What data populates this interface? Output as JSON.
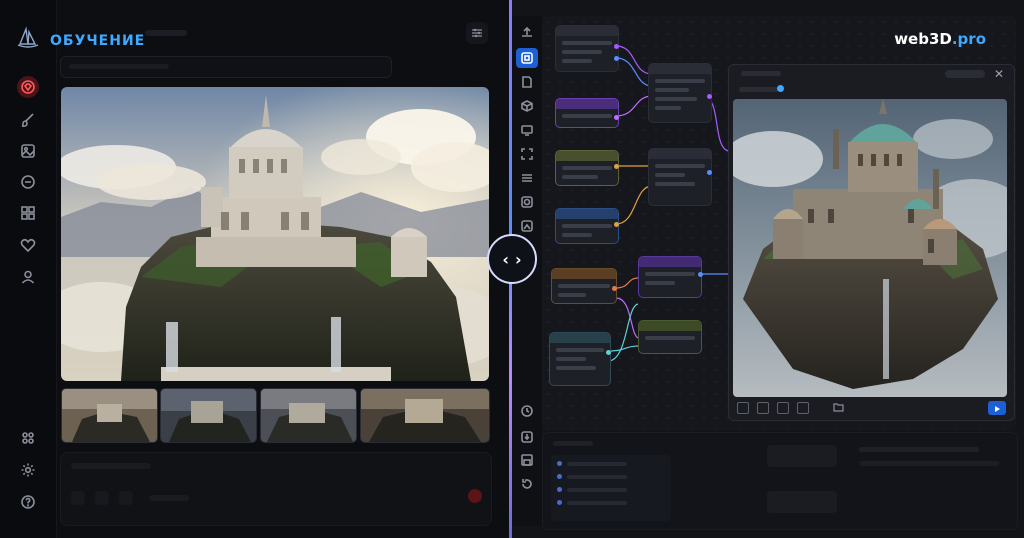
{
  "left_app": {
    "title": "ОБУЧЕНИЕ",
    "rail_icons": [
      "gem-icon",
      "brush-icon",
      "image-icon",
      "chat-icon",
      "grid-icon",
      "heart-icon",
      "user-icon",
      "apps-icon",
      "settings-icon",
      "help-icon"
    ],
    "active_rail_icon": "gem-icon",
    "accent_color": "#3fa8ff",
    "active_color": "#ff5a5a",
    "thumbnails": [
      "thumb-1",
      "thumb-2",
      "thumb-3",
      "thumb-4"
    ]
  },
  "right_app": {
    "brand": {
      "name": "web3D",
      "suffix": ".pro"
    },
    "rail_icons": [
      "upload-icon",
      "nodes-icon",
      "file-icon",
      "cube-icon",
      "monitor-icon",
      "frame-icon",
      "list-icon",
      "camera-icon",
      "gallery-icon",
      "history-icon",
      "export-icon",
      "save-icon",
      "reset-icon"
    ],
    "active_rail_icon": "nodes-icon",
    "accent_color": "#1d5fd6"
  },
  "compare_handle": {
    "icon": "compare-arrows-icon",
    "left": "‹",
    "right": "›"
  }
}
